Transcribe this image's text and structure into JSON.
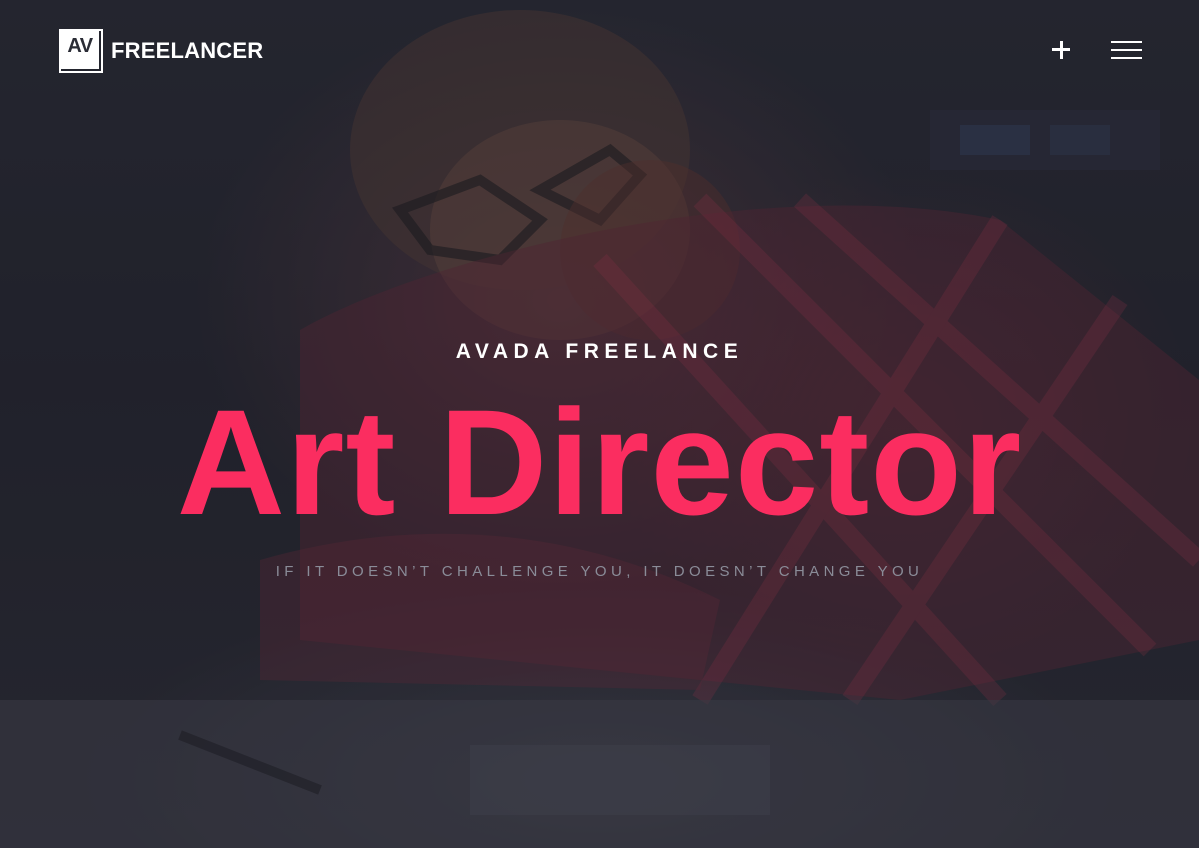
{
  "header": {
    "logo": {
      "mark": "AV",
      "text": "FREELANCER"
    },
    "plus_icon": "plus-icon",
    "menu_icon": "hamburger-menu-icon"
  },
  "hero": {
    "eyebrow": "AVADA FREELANCE",
    "headline": "Art Director",
    "tagline": "IF IT DOESN’T CHALLENGE YOU, IT DOESN’T CHANGE YOU"
  },
  "colors": {
    "accent": "#fb2d60",
    "overlay": "#25262f",
    "tagline": "#8a8c98",
    "text": "#ffffff"
  }
}
